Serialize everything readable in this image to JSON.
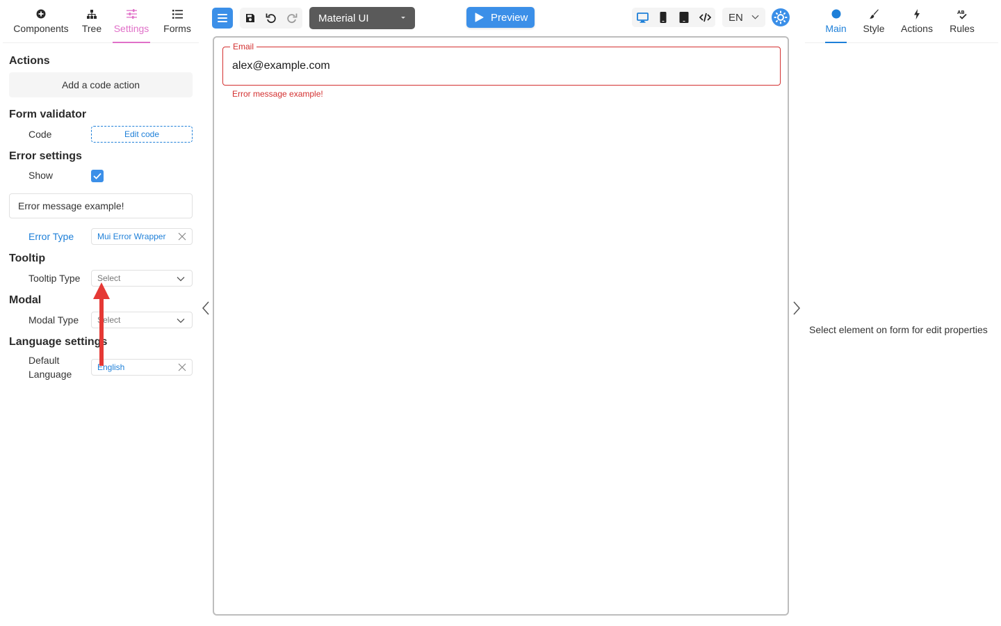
{
  "left_tabs": [
    {
      "label": "Components",
      "icon": "plus-circle-icon"
    },
    {
      "label": "Tree",
      "icon": "sitemap-icon"
    },
    {
      "label": "Settings",
      "icon": "sliders-icon",
      "active": true
    },
    {
      "label": "Forms",
      "icon": "list-icon"
    }
  ],
  "settings": {
    "actions": {
      "title": "Actions",
      "add_button": "Add a code action"
    },
    "form_validator": {
      "title": "Form validator",
      "code_label": "Code",
      "edit_button": "Edit code"
    },
    "error_settings": {
      "title": "Error settings",
      "show_label": "Show",
      "show_checked": true,
      "message_value": "Error message example!",
      "type_label": "Error Type",
      "type_value": "Mui Error Wrapper"
    },
    "tooltip": {
      "title": "Tooltip",
      "type_label": "Tooltip Type",
      "type_placeholder": "Select"
    },
    "modal": {
      "title": "Modal",
      "type_label": "Modal Type",
      "type_placeholder": "Select"
    },
    "language": {
      "title": "Language settings",
      "default_label_line1": "Default",
      "default_label_line2": "Language",
      "default_value": "English"
    }
  },
  "toolbar": {
    "ui_library": "Material UI",
    "preview_label": "Preview",
    "language": "EN"
  },
  "canvas": {
    "email_label": "Email",
    "email_value": "alex@example.com",
    "error_text": "Error message example!"
  },
  "right_tabs": [
    {
      "label": "Main",
      "icon": "circle-icon",
      "active": true
    },
    {
      "label": "Style",
      "icon": "brush-icon"
    },
    {
      "label": "Actions",
      "icon": "bolt-icon"
    },
    {
      "label": "Rules",
      "icon": "spellcheck-icon"
    }
  ],
  "right_panel": {
    "hint": "Select element on form for edit properties"
  },
  "colors": {
    "accent": "#3b8fe8",
    "settings_active": "#e070c8",
    "error": "#d32f2f",
    "annotation_arrow": "#e53935"
  }
}
